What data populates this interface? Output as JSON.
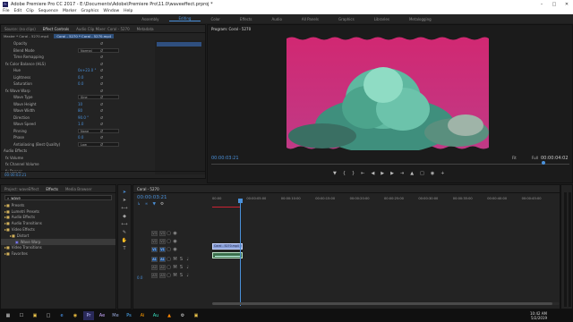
{
  "window": {
    "title": "Adobe Premiere Pro CC 2017 - E:\\Documents\\Adobe\\Premiere Pro\\11.0\\waveeffect.prproj *",
    "minimize": "–",
    "maximize": "□",
    "close": "✕"
  },
  "menu": [
    "File",
    "Edit",
    "Clip",
    "Sequence",
    "Marker",
    "Graphics",
    "Window",
    "Help"
  ],
  "workspaces": [
    "Assembly",
    "Editing",
    "Color",
    "Effects",
    "Audio",
    "All Panels",
    "Graphics",
    "Libraries",
    "Metalogging"
  ],
  "active_workspace": "Editing",
  "effect_controls": {
    "tabs": [
      "Source: (no clips)",
      "Effect Controls",
      "Audio Clip Mixer: Coral - 5270",
      "Metadata"
    ],
    "clip_header": "Master * Coral - 5270.mp4",
    "sequence_clip": "Coral - 5270 * Coral - 5270.mp4",
    "rows": [
      {
        "label": "Opacity",
        "type": "text",
        "value": ""
      },
      {
        "label": "Blend Mode",
        "type": "select",
        "value": "Normal"
      },
      {
        "label": "Time Remapping",
        "type": "text",
        "value": ""
      },
      {
        "label": "fx  Color Balance (HLS)",
        "type": "text",
        "value": ""
      },
      {
        "label": "Hue",
        "type": "value",
        "value": "0x+23.0 °"
      },
      {
        "label": "Lightness",
        "type": "value",
        "value": "0.0"
      },
      {
        "label": "Saturation",
        "type": "value",
        "value": "0.0"
      },
      {
        "label": "fx  Wave Warp",
        "type": "text",
        "value": ""
      },
      {
        "label": "Wave Type",
        "type": "select",
        "value": "Sine"
      },
      {
        "label": "Wave Height",
        "type": "value",
        "value": "10"
      },
      {
        "label": "Wave Width",
        "type": "value",
        "value": "80"
      },
      {
        "label": "Direction",
        "type": "value",
        "value": "90.0 °"
      },
      {
        "label": "Wave Speed",
        "type": "value",
        "value": "1.0"
      },
      {
        "label": "Pinning",
        "type": "select",
        "value": "None"
      },
      {
        "label": "Phase",
        "type": "value",
        "value": "0.0"
      },
      {
        "label": "Antialiasing (Best Quality)",
        "type": "select",
        "value": "Low"
      }
    ],
    "audio_effects": "Audio Effects",
    "audio_rows": [
      "fx  Volume",
      "fx  Channel Volume",
      "fx  Panner"
    ],
    "timecode": "00:00:03:21"
  },
  "program": {
    "title": "Program: Coral - 5270",
    "timecode_left": "00:00:03:21",
    "fit": "Fit",
    "full": "Full",
    "timecode_right": "00:00:04:02"
  },
  "project": {
    "tabs": [
      "Project: waveEffect",
      "Effects",
      "Media Browser"
    ],
    "search_value": "wave",
    "tree": [
      {
        "label": "Presets",
        "indent": 0
      },
      {
        "label": "Lumetri Presets",
        "indent": 0
      },
      {
        "label": "Audio Effects",
        "indent": 0
      },
      {
        "label": "Audio Transitions",
        "indent": 0
      },
      {
        "label": "Video Effects",
        "indent": 0
      },
      {
        "label": "Distort",
        "indent": 1
      },
      {
        "label": "Wave Warp",
        "indent": 2
      },
      {
        "label": "Video Transitions",
        "indent": 0
      },
      {
        "label": "Favorites",
        "indent": 0
      }
    ]
  },
  "timeline": {
    "tab": "Coral - 5270",
    "timecode": "00:00:03:21",
    "ruler": [
      "00:00",
      "00:00:05:00",
      "00:00:10:00",
      "00:00:15:00",
      "00:00:20:00",
      "00:00:25:00",
      "00:00:30:00",
      "00:00:35:00",
      "00:00:40:00",
      "00:00:45:00"
    ],
    "tracks": [
      "V3",
      "V2",
      "V1",
      "A1",
      "A2",
      "A3"
    ],
    "clip_label": "Coral - 5270.mp4 [V]",
    "master_value": "0.0"
  },
  "taskbar": {
    "time": "10:42 AM",
    "date": "5/2/2019"
  },
  "colors": {
    "accent": "#4a90d9",
    "panel": "#232323",
    "frame_pink": "#d32f74"
  }
}
